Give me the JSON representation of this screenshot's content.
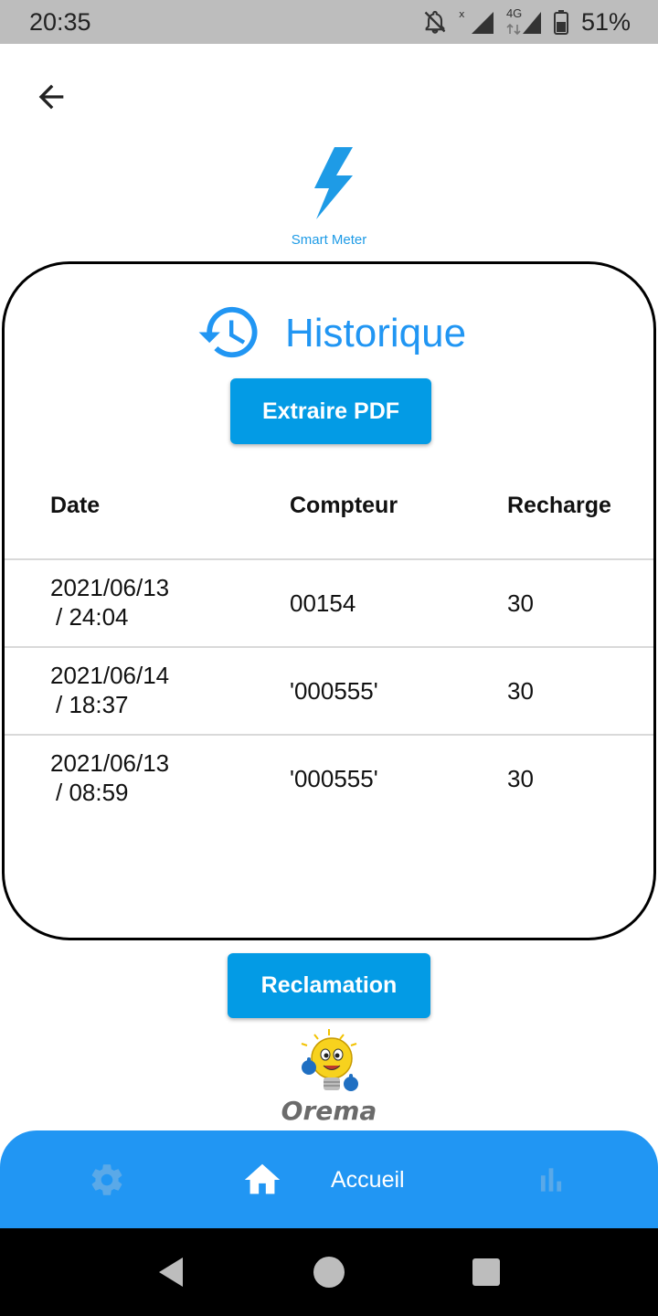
{
  "status_bar": {
    "time": "20:35",
    "network": "4G",
    "battery": "51%",
    "icons": [
      "notifications-off-icon",
      "signal-icon",
      "signal-4g-icon",
      "battery-icon"
    ]
  },
  "header": {
    "back_icon": "arrow-back-icon",
    "logo_text": "Smart Meter",
    "logo_icon": "lightning-bolt-icon"
  },
  "card": {
    "title": "Historique",
    "title_icon": "history-icon",
    "extract_button": "Extraire PDF",
    "table": {
      "columns": [
        "Date",
        "Compteur",
        "Recharge"
      ],
      "rows": [
        {
          "date": "2021/06/13",
          "time": "/ 24:04",
          "compteur": "00154",
          "recharge": "30"
        },
        {
          "date": "2021/06/14",
          "time": "/ 18:37",
          "compteur": "'000555'",
          "recharge": "30"
        },
        {
          "date": "2021/06/13",
          "time": "/ 08:59",
          "compteur": "'000555'",
          "recharge": "30"
        }
      ]
    }
  },
  "reclamation_button": "Reclamation",
  "brand_logo": "Orema",
  "bottom_nav": {
    "items": [
      {
        "icon": "settings-icon",
        "label": ""
      },
      {
        "icon": "home-icon",
        "label": "Accueil",
        "active": true
      },
      {
        "icon": "bar-chart-icon",
        "label": ""
      }
    ]
  },
  "colors": {
    "accent": "#2196f3",
    "button": "#039be5",
    "status_bar": "#bdbdbd"
  }
}
